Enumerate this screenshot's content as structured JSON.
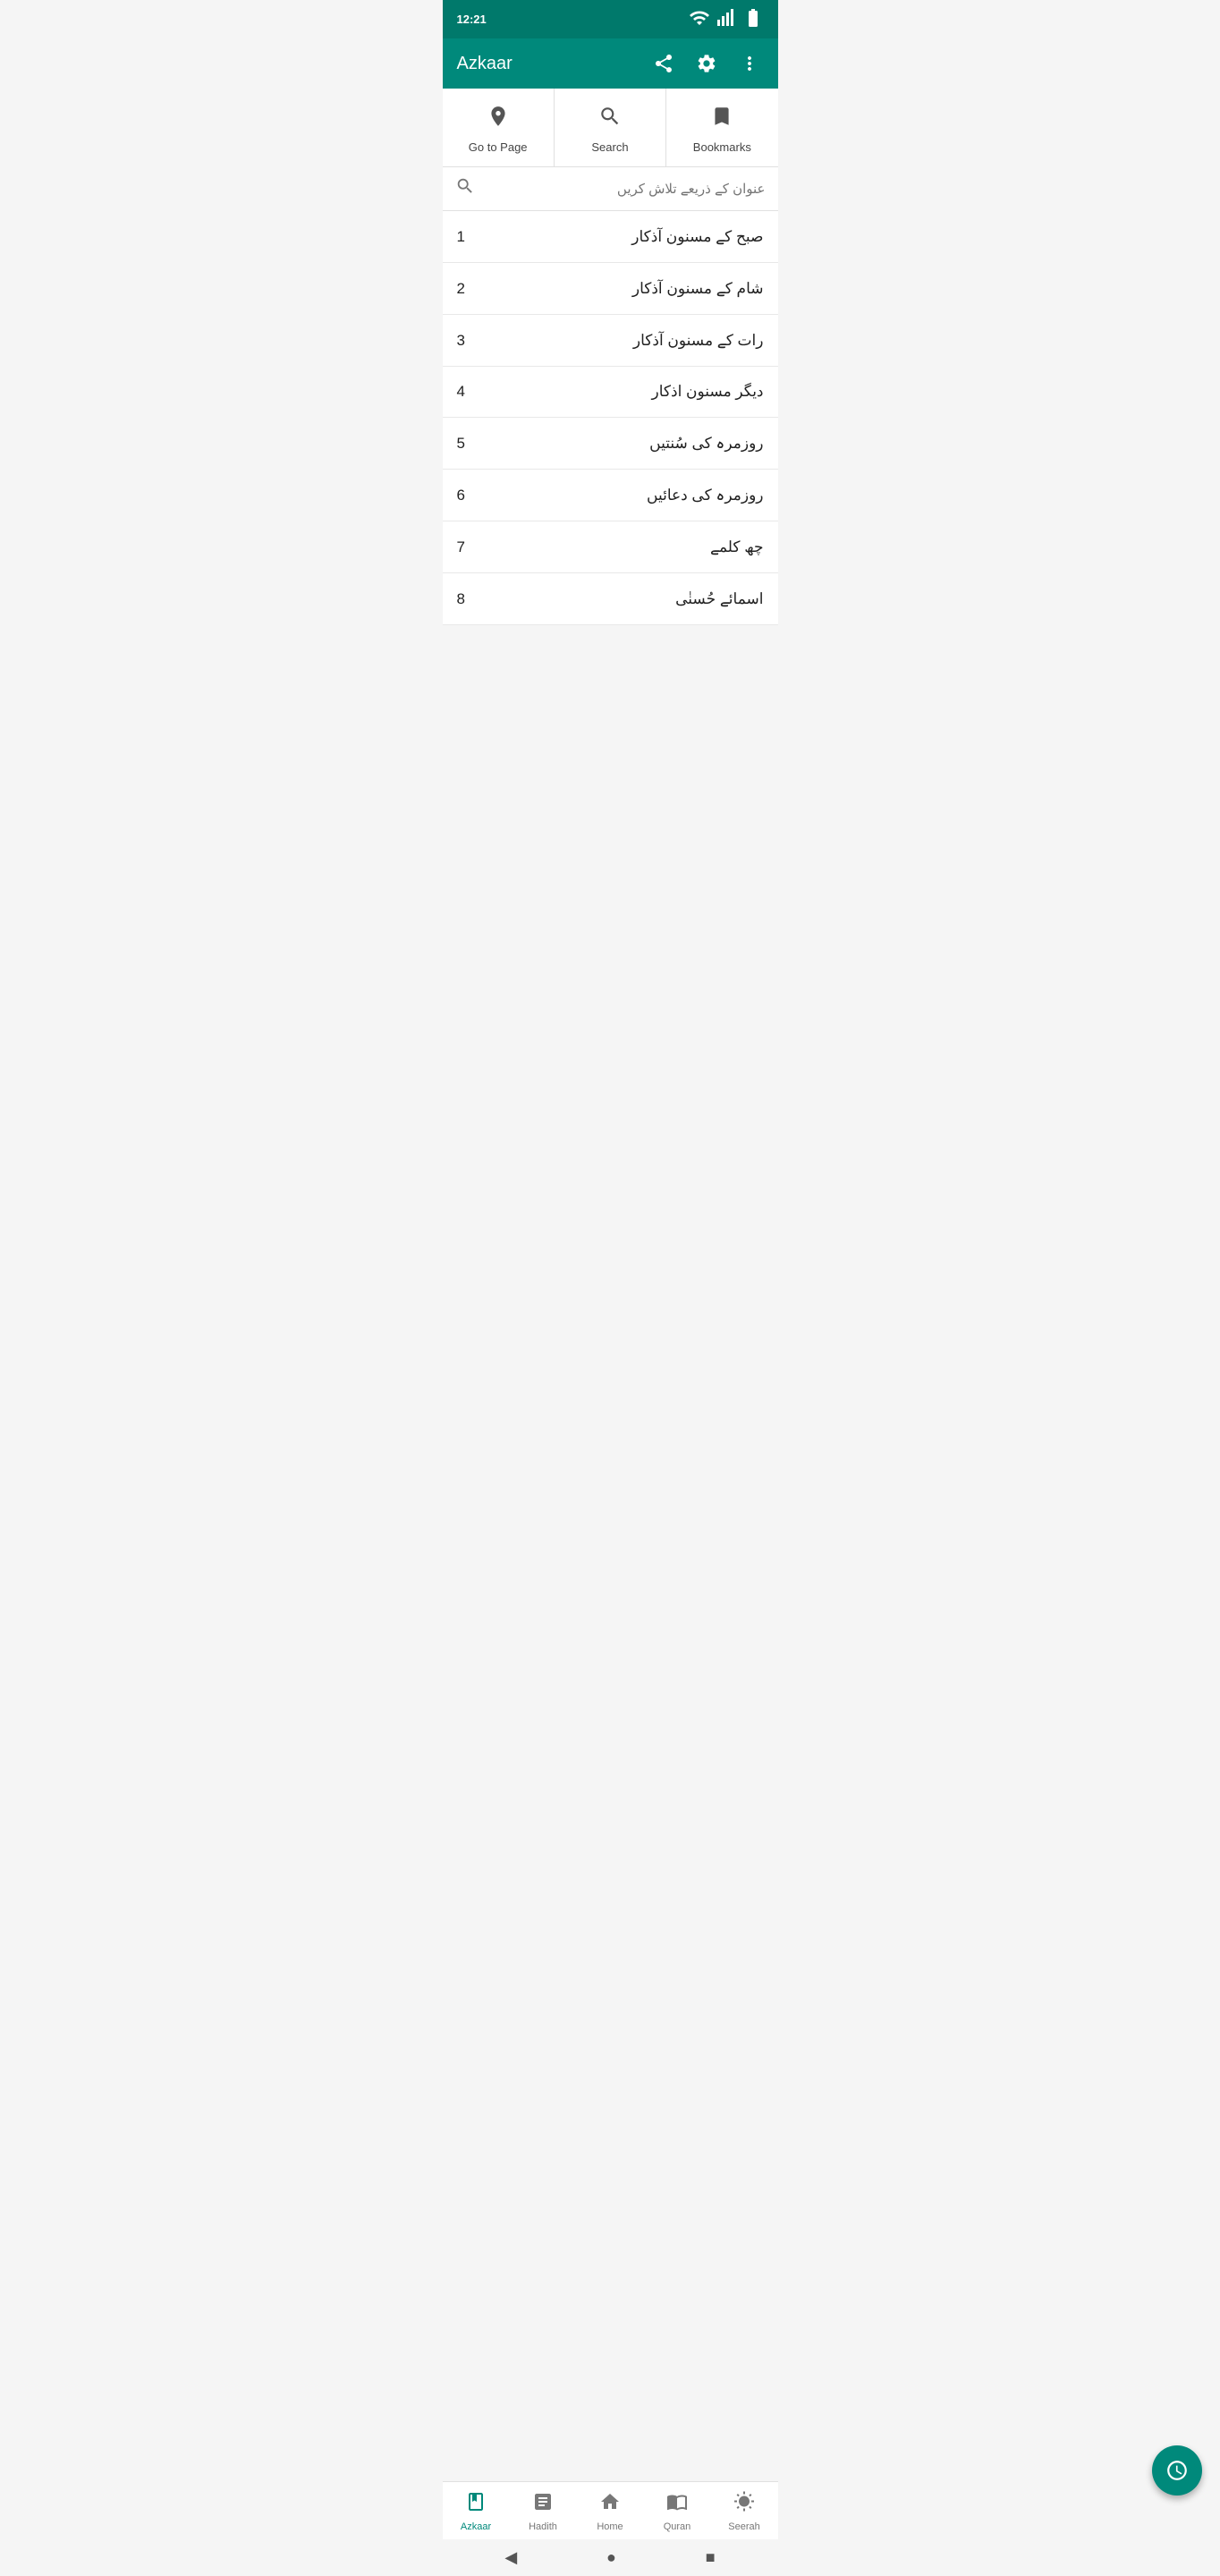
{
  "statusBar": {
    "time": "12:21",
    "icons": [
      "wifi",
      "signal",
      "battery"
    ]
  },
  "topBar": {
    "title": "Azkaar",
    "icons": [
      "share",
      "settings",
      "more"
    ]
  },
  "quickActions": [
    {
      "id": "go-to-page",
      "label": "Go to Page",
      "icon": "navigate"
    },
    {
      "id": "search",
      "label": "Search",
      "icon": "search"
    },
    {
      "id": "bookmarks",
      "label": "Bookmarks",
      "icon": "bookmark"
    }
  ],
  "searchBar": {
    "placeholder": "عنوان کے ذریعے تلاش کریں"
  },
  "listItems": [
    {
      "number": 1,
      "text": "صبح کے مسنون آذکار"
    },
    {
      "number": 2,
      "text": "شام کے مسنون آذکار"
    },
    {
      "number": 3,
      "text": "رات کے مسنون آذکار"
    },
    {
      "number": 4,
      "text": "دیگر مسنون اذکار"
    },
    {
      "number": 5,
      "text": "روزمرہ کی سُنتیں"
    },
    {
      "number": 6,
      "text": "روزمرہ کی دعائیں"
    },
    {
      "number": 7,
      "text": "چھ کلمے"
    },
    {
      "number": 8,
      "text": "اسمائے حُسنٰی"
    }
  ],
  "fab": {
    "icon": "clock",
    "label": "Schedule"
  },
  "bottomNav": [
    {
      "id": "azkaar",
      "label": "Azkaar",
      "icon": "book",
      "active": true
    },
    {
      "id": "hadith",
      "label": "Hadith",
      "icon": "hadith"
    },
    {
      "id": "home",
      "label": "Home",
      "icon": "home"
    },
    {
      "id": "quran",
      "label": "Quran",
      "icon": "quran"
    },
    {
      "id": "seerah",
      "label": "Seerah",
      "icon": "sun"
    }
  ],
  "systemBar": {
    "buttons": [
      "back",
      "home",
      "recent"
    ]
  }
}
